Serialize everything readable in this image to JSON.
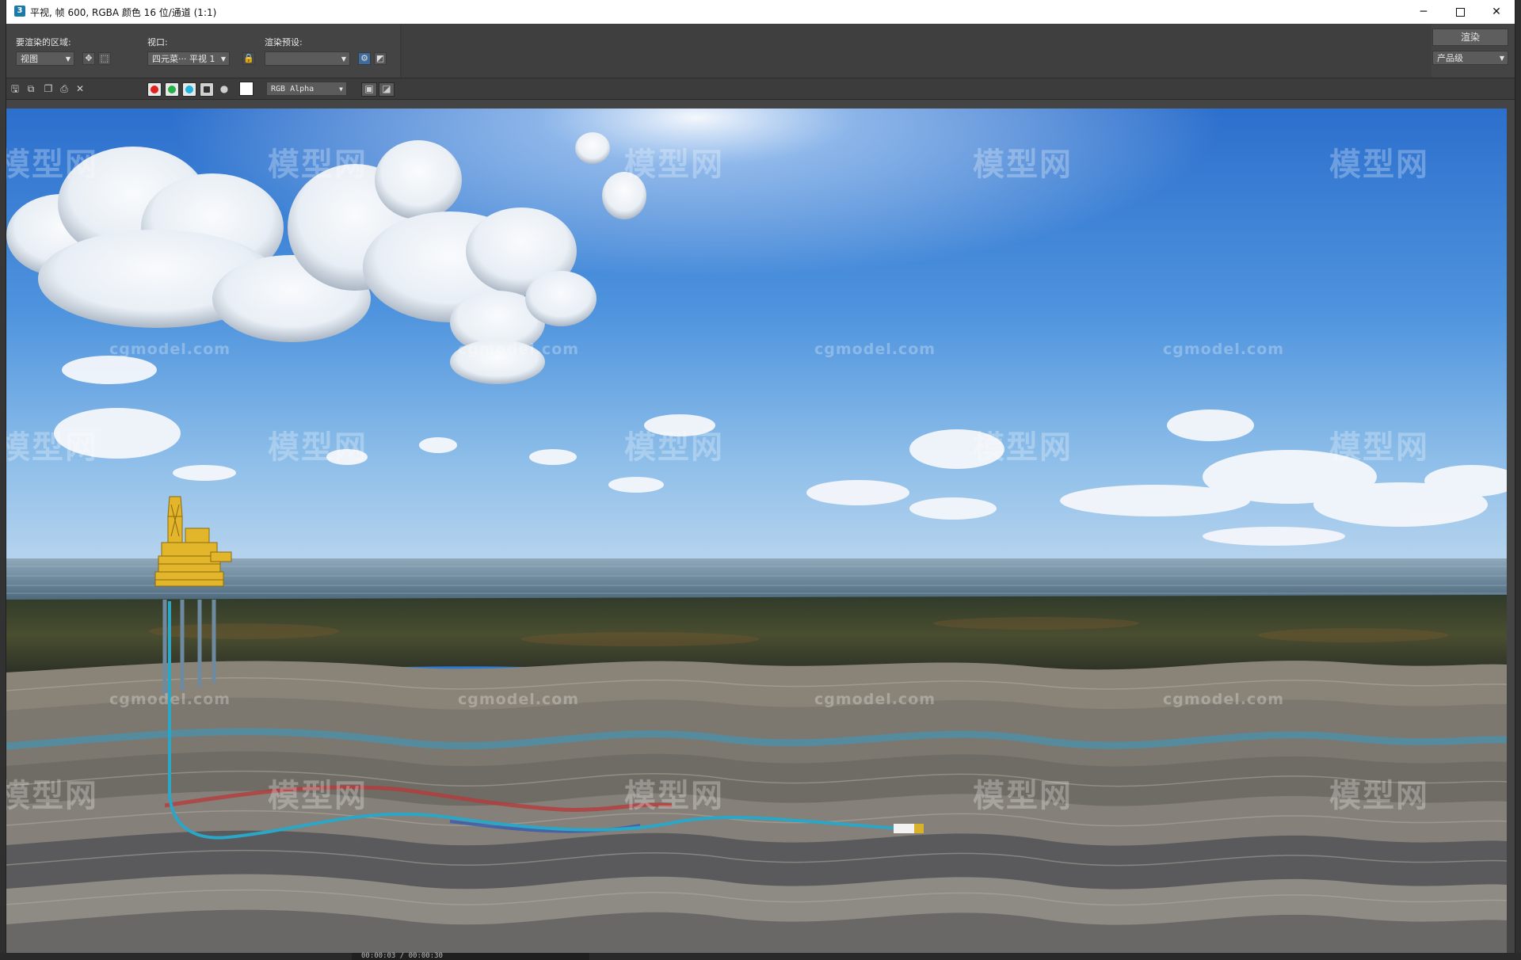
{
  "window": {
    "title": "平视, 帧 600, RGBA 颜色 16 位/通道 (1:1)",
    "app_icon_label": "3",
    "minimize_glyph": "─",
    "close_glyph": "✕"
  },
  "panel": {
    "area_label": "要渲染的区域:",
    "area_value": "视图",
    "viewport_label": "视口:",
    "viewport_value": "四元菜··· 平视 1",
    "preset_label": "渲染预设:",
    "preset_value": "",
    "render_button": "渲染",
    "quality_value": "产品级"
  },
  "toolbar": {
    "channel_value": "RGB Alpha",
    "channel_colors": {
      "red": "#e02020",
      "green": "#26b04a",
      "blue": "#1fb4d8",
      "alpha": "#303030",
      "mono": "#9a9a9a"
    }
  },
  "watermarks": {
    "logo_text": "模型网",
    "url_text": "cgmodel.com"
  },
  "status": {
    "time_text": "00:00:03 / 00:00:30"
  },
  "colors": {
    "sky_top": "#1f6fd1",
    "sky_horizon": "#9cc6ec",
    "sea": "#5f7f96",
    "seabed": "#3d4a32",
    "platform": "#e3b52a",
    "pipe": "#2aa6c7"
  }
}
